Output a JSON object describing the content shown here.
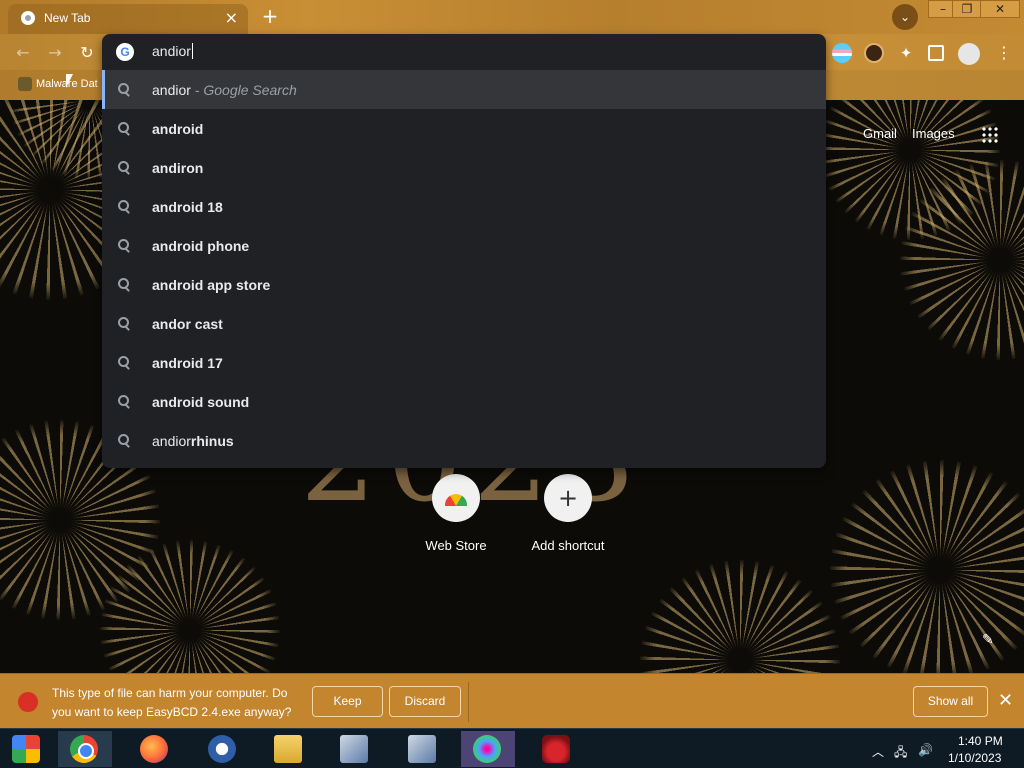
{
  "tab": {
    "title": "New Tab",
    "close_icon": "×"
  },
  "new_tab_icon": "+",
  "tab_search_icon": "⌄",
  "window_controls": {
    "minimize": "–",
    "maximize": "❐",
    "close": "✕"
  },
  "nav": {
    "back": "←",
    "forward": "→",
    "reload": "↻"
  },
  "toolbar_icons": {
    "extensions": "✦",
    "menu": "⋮"
  },
  "bookmarks": [
    {
      "label": "Malware Dat"
    }
  ],
  "omnibox": {
    "logo": "G",
    "text": "andior",
    "suggestions": [
      {
        "prefix": "andior",
        "suffix": " - Google Search",
        "selected": true
      },
      {
        "text": "android"
      },
      {
        "text": "andiron"
      },
      {
        "text": "android 18"
      },
      {
        "text": "android phone"
      },
      {
        "text": "android app store"
      },
      {
        "text": "andor cast"
      },
      {
        "text": "android 17"
      },
      {
        "text": "android sound"
      },
      {
        "prefix": "andior",
        "bold": "rhinus"
      }
    ]
  },
  "ntp": {
    "gmail": "Gmail",
    "images": "Images",
    "background_year": "2023",
    "shortcuts": [
      {
        "label": "Web Store"
      },
      {
        "label": "Add shortcut",
        "icon": "+"
      }
    ],
    "customize_icon": "✎"
  },
  "download_bar": {
    "message": "This type of file can harm your computer. Do you want to keep EasyBCD 2.4.exe anyway?",
    "keep": "Keep",
    "discard": "Discard",
    "show_all": "Show all",
    "close": "✕"
  },
  "taskbar": {
    "tray_chevron": "︿",
    "tray_network": "🖧",
    "tray_volume": "🔊",
    "time": "1:40 PM",
    "date": "1/10/2023"
  },
  "colors": {
    "accent": "#8ab4f8",
    "popup_bg": "#202124",
    "download_bar": "#c3852e"
  }
}
